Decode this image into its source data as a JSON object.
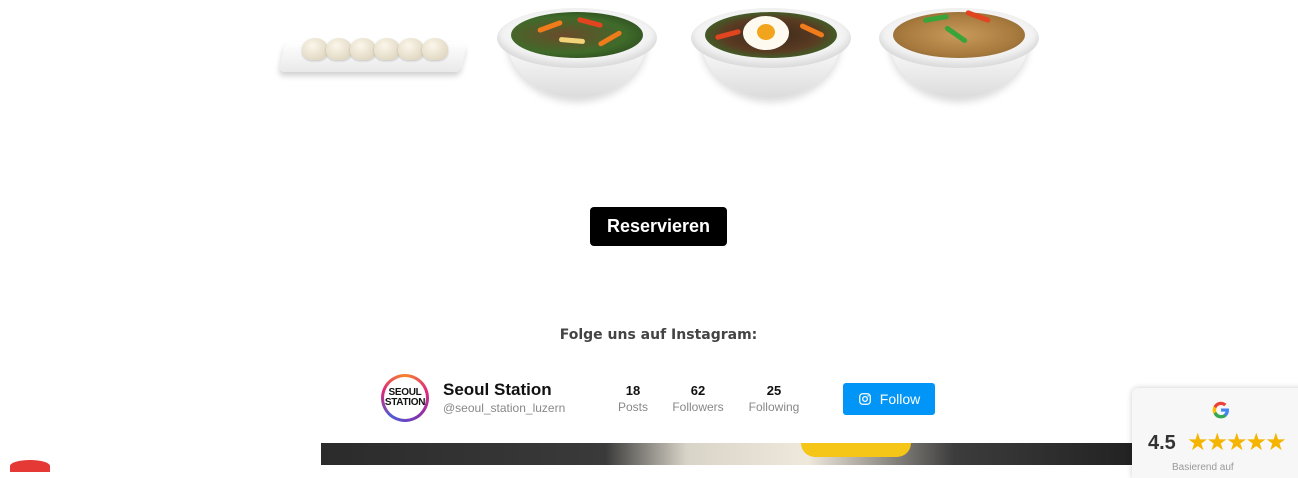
{
  "dishes": [
    {
      "name": "dumplings"
    },
    {
      "name": "bibimbap"
    },
    {
      "name": "bibimbap-egg"
    },
    {
      "name": "fried-rice"
    }
  ],
  "cta": {
    "reserve_label": "Reservieren"
  },
  "instagram": {
    "heading": "Folge uns auf Instagram:",
    "avatar_text_line1": "SEOUL",
    "avatar_text_line2": "STATION",
    "account_name": "Seoul Station",
    "handle": "@seoul_station_luzern",
    "stats": [
      {
        "value": "18",
        "label": "Posts"
      },
      {
        "value": "62",
        "label": "Followers"
      },
      {
        "value": "25",
        "label": "Following"
      }
    ],
    "follow_label": "Follow",
    "follow_icon": "instagram-icon",
    "accent_color": "#0095f6"
  },
  "review_badge": {
    "provider_icon": "google-icon",
    "rating": "4.5",
    "stars": "★★★★★",
    "star_value": 4.5,
    "subtext": "Basierend auf"
  }
}
